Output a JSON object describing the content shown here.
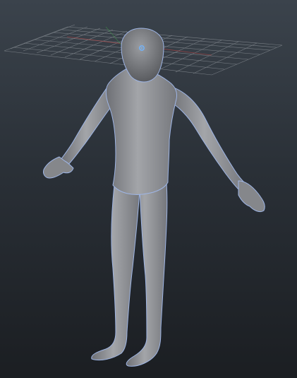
{
  "viewport": {
    "background_top": "#3b434c",
    "background_bottom": "#1b1e22",
    "grid_color": "#8f959b",
    "model_color": "#8e8f93",
    "selection_outline_color": "#9fb6e6",
    "pivot_color": "#6fb4ff",
    "icons": [
      "ground-grid-icon",
      "pivot-icon"
    ]
  }
}
